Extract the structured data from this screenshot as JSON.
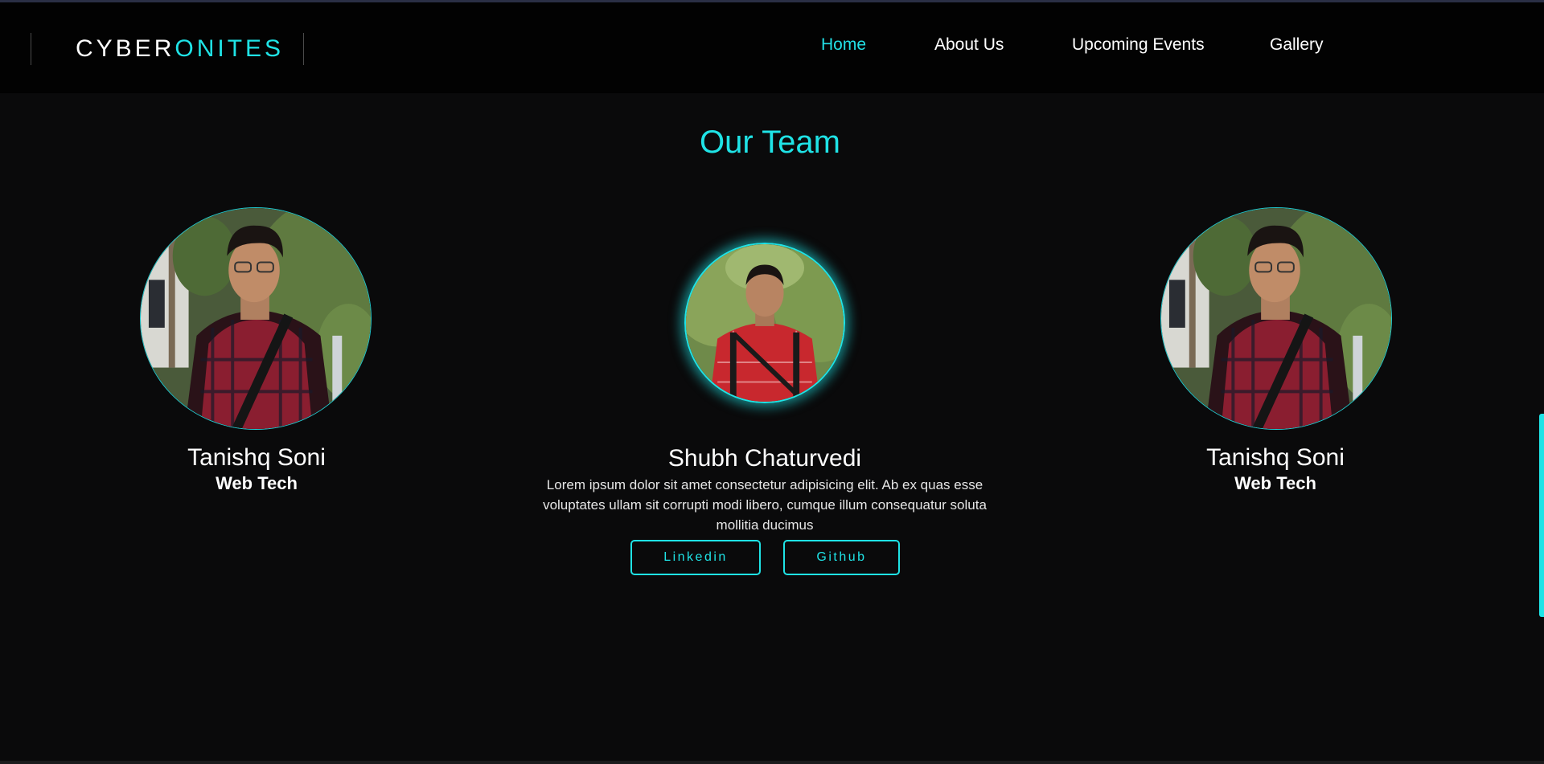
{
  "brand": {
    "part1": "CYBER",
    "part2": "ONITES"
  },
  "nav": {
    "home": "Home",
    "about": "About Us",
    "events": "Upcoming Events",
    "gallery": "Gallery"
  },
  "team": {
    "title": "Our Team",
    "members": [
      {
        "name": "Tanishq Soni",
        "role": "Web Tech"
      },
      {
        "name": "Shubh Chaturvedi",
        "bio": "Lorem ipsum dolor sit amet consectetur adipisicing elit. Ab ex quas esse voluptates ullam sit corrupti modi libero, cumque illum consequatur soluta mollitia ducimus",
        "linkedin_label": "Linkedin",
        "github_label": "Github"
      },
      {
        "name": "Tanishq Soni",
        "role": "Web Tech"
      }
    ]
  },
  "colors": {
    "accent": "#1fe3e6",
    "background": "#0a0a0b",
    "navbar": "#020202"
  }
}
